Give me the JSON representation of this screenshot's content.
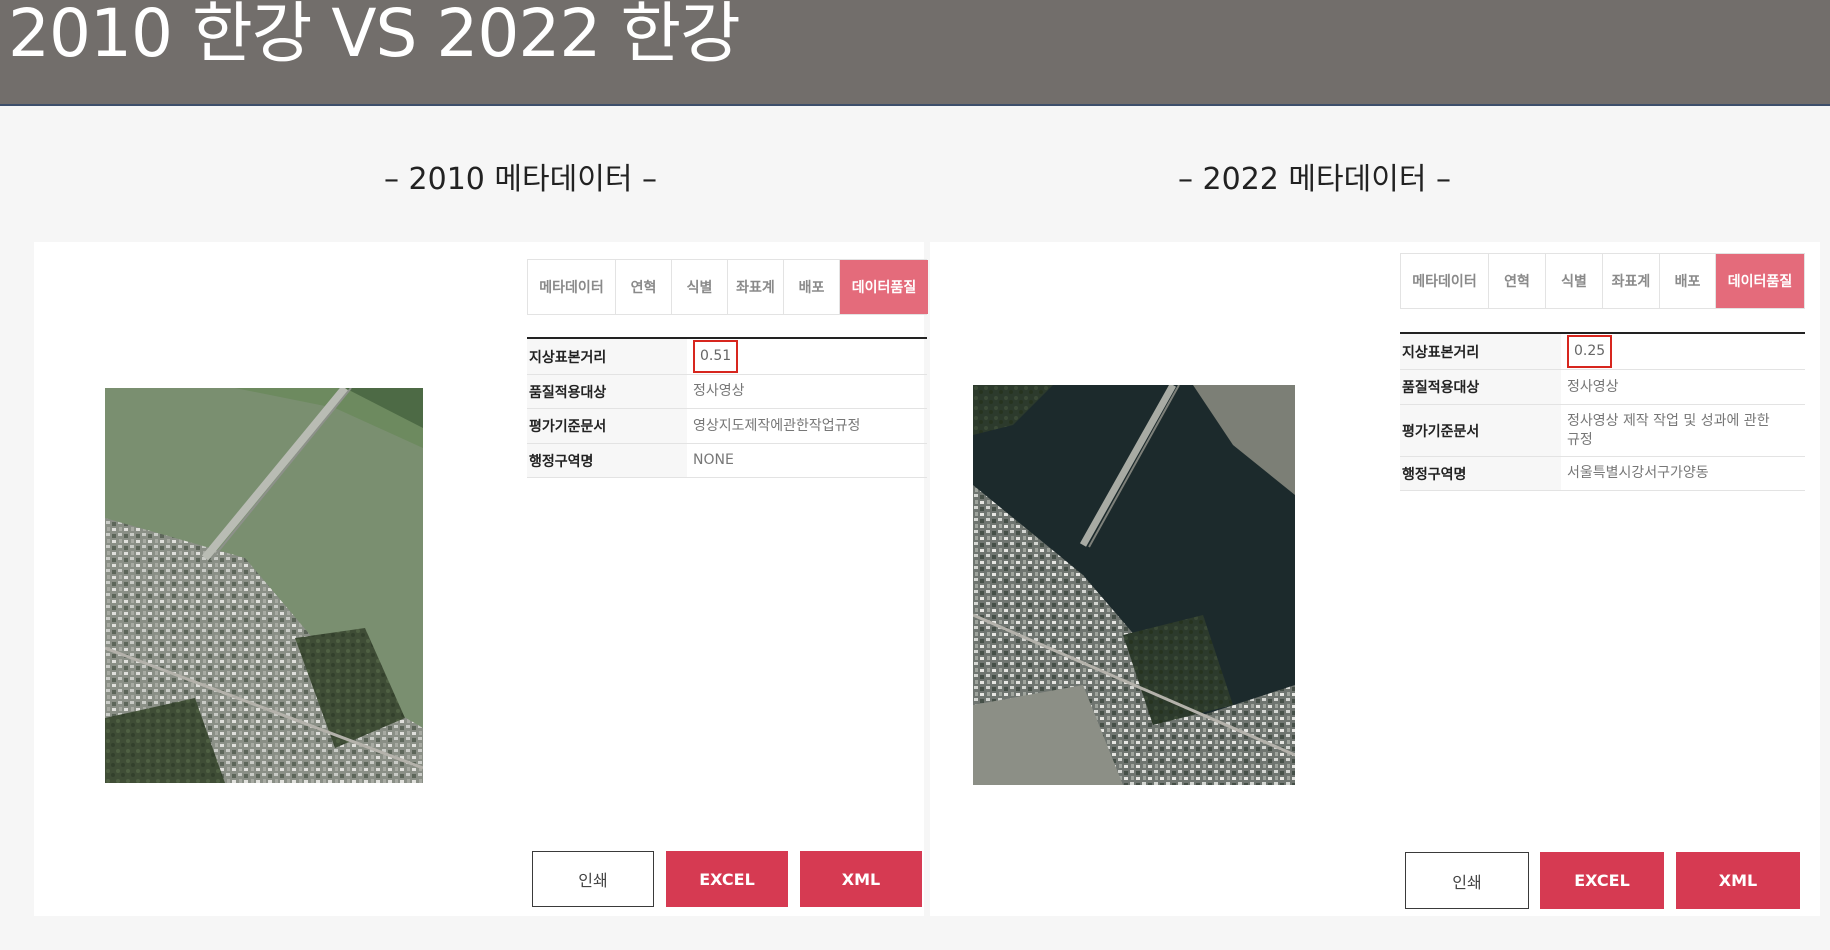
{
  "slide": {
    "title": "2010 한강  VS 2022 한강"
  },
  "left": {
    "heading": "– 2010 메타데이터 –",
    "tabs": [
      "메타데이터",
      "연혁",
      "식별",
      "좌표계",
      "배포",
      "데이터품질"
    ],
    "active_tab": "데이터품질",
    "rows": [
      {
        "key": "지상표본거리",
        "value": "0.51"
      },
      {
        "key": "품질적용대상",
        "value": "정사영상"
      },
      {
        "key": "평가기준문서",
        "value": "영상지도제작에관한작업규정"
      },
      {
        "key": "행정구역명",
        "value": "NONE"
      }
    ],
    "buttons": {
      "print": "인쇄",
      "excel": "EXCEL",
      "xml": "XML"
    }
  },
  "right": {
    "heading": "– 2022 메타데이터 –",
    "tabs": [
      "메타데이터",
      "연혁",
      "식별",
      "좌표계",
      "배포",
      "데이터품질"
    ],
    "active_tab": "데이터품질",
    "rows": [
      {
        "key": "지상표본거리",
        "value": "0.25"
      },
      {
        "key": "품질적용대상",
        "value": "정사영상"
      },
      {
        "key": "평가기준문서",
        "value": "정사영상 제작 작업 및 성과에 관한 규정"
      },
      {
        "key": "행정구역명",
        "value": "서울특별시강서구가양동"
      }
    ],
    "buttons": {
      "print": "인쇄",
      "excel": "EXCEL",
      "xml": "XML"
    }
  },
  "colors": {
    "title_bar": "#726e6b",
    "active_tab": "#e46b7b",
    "button_red": "#d63a52",
    "highlight_box": "#d7261e"
  }
}
